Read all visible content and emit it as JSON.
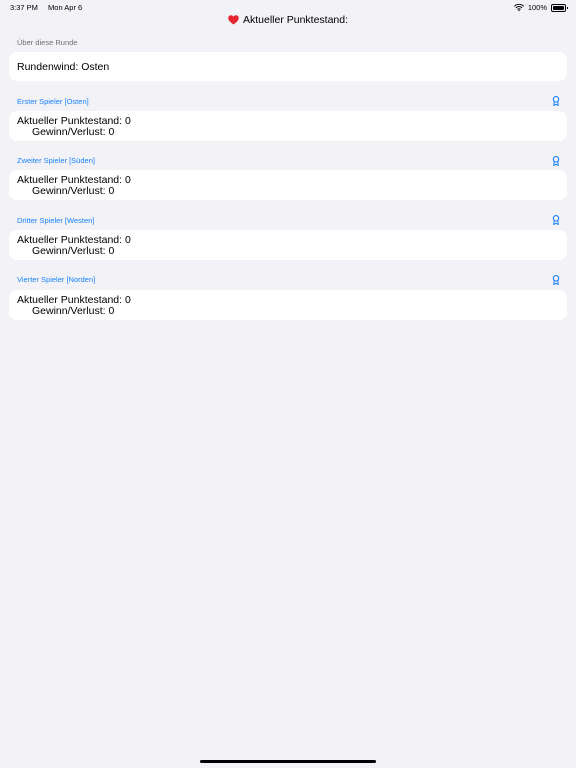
{
  "status": {
    "time": "3:37 PM",
    "date": "Mon Apr 6",
    "battery": "100%"
  },
  "nav": {
    "title": "Aktueller Punktestand:"
  },
  "round": {
    "header": "Über diese Runde",
    "wind": "Rundenwind: Osten"
  },
  "players": [
    {
      "header": "Erster Spieler [Osten]",
      "score": "Aktueller Punktestand: 0",
      "delta": "Gewinn/Verlust: 0"
    },
    {
      "header": "Zweiter Spieler [Süden]",
      "score": "Aktueller Punktestand: 0",
      "delta": "Gewinn/Verlust: 0"
    },
    {
      "header": "Dritter Spieler [Westen]",
      "score": "Aktueller Punktestand: 0",
      "delta": "Gewinn/Verlust: 0"
    },
    {
      "header": "Vierter Spieler [Norden]",
      "score": "Aktueller Punktestand: 0",
      "delta": "Gewinn/Verlust: 0"
    }
  ],
  "colors": {
    "accent": "#1a82fb",
    "heart": "#e8242e",
    "background": "#f2f2f7"
  }
}
